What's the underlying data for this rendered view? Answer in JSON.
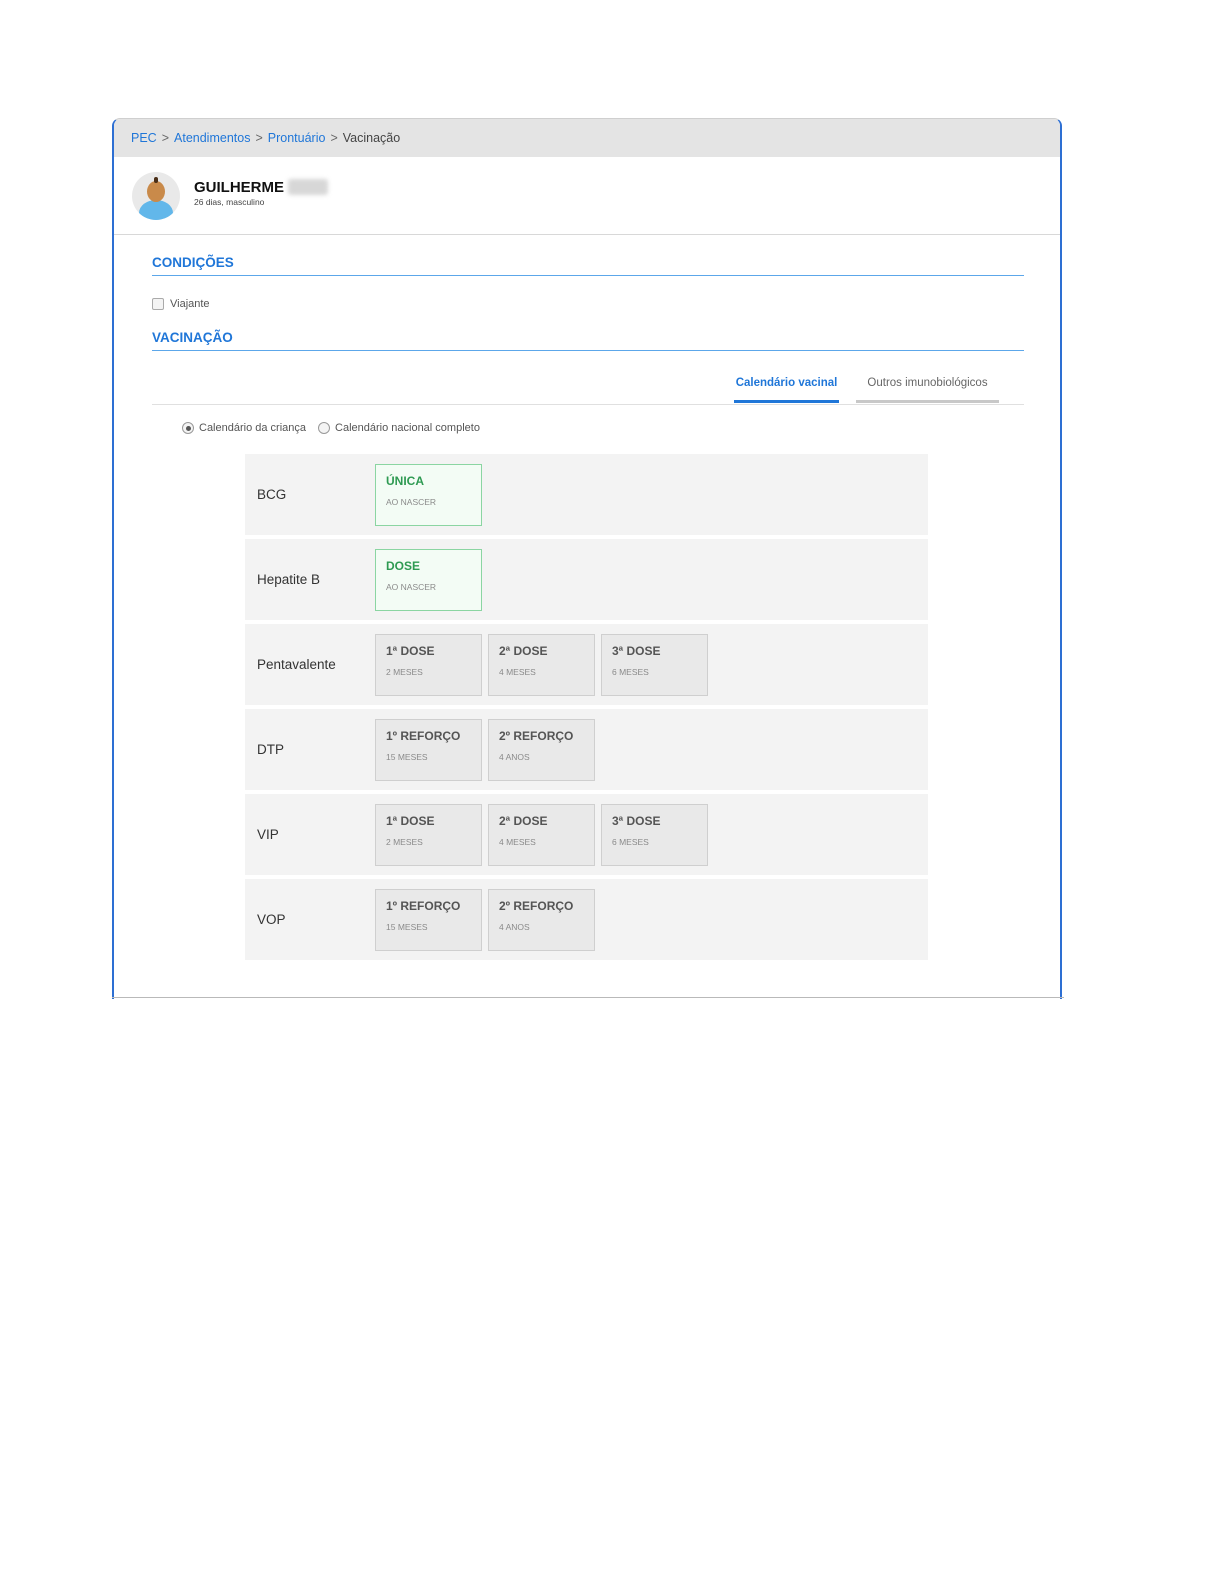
{
  "breadcrumb": {
    "items": [
      "PEC",
      "Atendimentos",
      "Prontuário"
    ],
    "current": "Vacinação",
    "separator": ">"
  },
  "patient": {
    "name": "GUILHERME",
    "details": "26 dias, masculino"
  },
  "conditions": {
    "title": "CONDIÇÕES",
    "traveler_label": "Viajante",
    "traveler_checked": false
  },
  "vaccination": {
    "title": "VACINAÇÃO",
    "tabs": [
      {
        "label": "Calendário vacinal",
        "active": true
      },
      {
        "label": "Outros imunobiológicos",
        "active": false
      }
    ],
    "radios": [
      {
        "label": "Calendário da criança",
        "checked": true
      },
      {
        "label": "Calendário nacional completo",
        "checked": false
      }
    ],
    "vaccines": [
      {
        "name": "BCG",
        "doses": [
          {
            "label": "ÚNICA",
            "age": "AO NASCER",
            "status": "green"
          }
        ]
      },
      {
        "name": "Hepatite B",
        "doses": [
          {
            "label": "DOSE",
            "age": "AO NASCER",
            "status": "green"
          }
        ]
      },
      {
        "name": "Pentavalente",
        "doses": [
          {
            "label": "1ª DOSE",
            "age": "2 MESES",
            "status": "gray"
          },
          {
            "label": "2ª DOSE",
            "age": "4 MESES",
            "status": "gray"
          },
          {
            "label": "3ª DOSE",
            "age": "6 MESES",
            "status": "gray"
          }
        ]
      },
      {
        "name": "DTP",
        "doses": [
          {
            "label": "1º REFORÇO",
            "age": "15 MESES",
            "status": "gray"
          },
          {
            "label": "2º REFORÇO",
            "age": "4 ANOS",
            "status": "gray"
          }
        ]
      },
      {
        "name": "VIP",
        "doses": [
          {
            "label": "1ª DOSE",
            "age": "2 MESES",
            "status": "gray"
          },
          {
            "label": "2ª DOSE",
            "age": "4 MESES",
            "status": "gray"
          },
          {
            "label": "3ª DOSE",
            "age": "6 MESES",
            "status": "gray"
          }
        ]
      },
      {
        "name": "VOP",
        "doses": [
          {
            "label": "1º REFORÇO",
            "age": "15 MESES",
            "status": "gray"
          },
          {
            "label": "2º REFORÇO",
            "age": "4 ANOS",
            "status": "gray"
          }
        ]
      }
    ]
  },
  "colors": {
    "accent": "#1f76d8",
    "dose_done_border": "#8bd5a2",
    "dose_done_text": "#2e9a52",
    "dose_pending_bg": "#e9e9e9"
  }
}
